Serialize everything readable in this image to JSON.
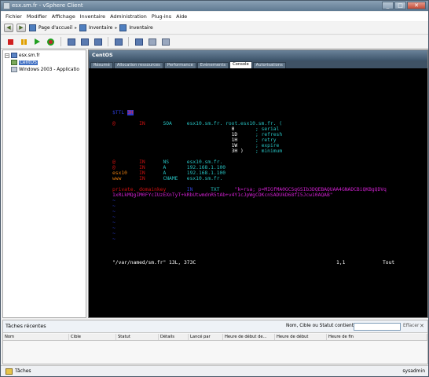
{
  "window": {
    "title": "esx.sm.fr - vSphere Client",
    "min": "_",
    "max": "□",
    "close": "✕"
  },
  "menu": [
    "Fichier",
    "Modifier",
    "Affichage",
    "Inventaire",
    "Administration",
    "Plug-ins",
    "Aide"
  ],
  "nav": {
    "home": "Page d'accueil",
    "inventory": "Inventaire",
    "inventory2": "Inventaire"
  },
  "toolbar": {
    "icons": [
      "power-off-icon",
      "suspend-icon",
      "power-on-icon",
      "reset-icon",
      "snapshot-icon",
      "revert-icon",
      "manage-icon",
      "console-icon",
      "migrate-icon",
      "clone-icon",
      "settings-icon"
    ]
  },
  "tree": {
    "host": "esx.sm.fr",
    "items": [
      {
        "label": "CentOS",
        "selected": true
      },
      {
        "label": "Windows 2003 - Applicatio",
        "selected": false
      }
    ]
  },
  "vm_panel": {
    "title": "CentOS",
    "tabs": [
      "Résumé",
      "Allocation ressources",
      "Performance",
      "Evènements",
      "Console",
      "Autorisations"
    ],
    "active_tab": "Console"
  },
  "console": {
    "lines": [
      {
        "text": "$TTL 3H",
        "color": "#2a3ad0",
        "tokens": [
          {
            "t": "$TTL ",
            "c": "#2a3ad0"
          },
          {
            "t": "3H",
            "c": "#ff2a2a",
            "bg": "#2a3ad0"
          }
        ]
      },
      {
        "text": "@        IN      SOA     esx10.sm.fr. root.esx10.sm.fr. (",
        "tokens": [
          {
            "t": "@        IN      ",
            "c": "#d01010"
          },
          {
            "t": "SOA     esx10.sm.fr. root.esx10.sm.fr. (",
            "c": "#27c0c0"
          }
        ]
      },
      {
        "text": "                                        0       ; serial",
        "tokens": [
          {
            "t": "                                        0       ",
            "c": "#ffffff"
          },
          {
            "t": "; serial",
            "c": "#27c0c0"
          }
        ]
      },
      {
        "text": "                                        1D      ; refresh",
        "tokens": [
          {
            "t": "                                        1D      ",
            "c": "#ffffff"
          },
          {
            "t": "; refresh",
            "c": "#27c0c0"
          }
        ]
      },
      {
        "text": "                                        1H      ; retry",
        "tokens": [
          {
            "t": "                                        1H      ",
            "c": "#ffffff"
          },
          {
            "t": "; retry",
            "c": "#27c0c0"
          }
        ]
      },
      {
        "text": "                                        1W      ; expire",
        "tokens": [
          {
            "t": "                                        1W      ",
            "c": "#ffffff"
          },
          {
            "t": "; expire",
            "c": "#27c0c0"
          }
        ]
      },
      {
        "text": "                                        3H )    ; minimum",
        "tokens": [
          {
            "t": "                                        3H )    ",
            "c": "#ffffff"
          },
          {
            "t": "; minimum",
            "c": "#27c0c0"
          }
        ]
      },
      {
        "text": "",
        "tokens": []
      },
      {
        "text": "@        IN      NS      esx10.sm.fr.",
        "tokens": [
          {
            "t": "@        IN      ",
            "c": "#d01010"
          },
          {
            "t": "NS      esx10.sm.fr.",
            "c": "#27c0c0"
          }
        ]
      },
      {
        "text": "@        IN      A       192.168.1.100",
        "tokens": [
          {
            "t": "@        IN      ",
            "c": "#d01010"
          },
          {
            "t": "A       192.168.1.100",
            "c": "#27c0c0"
          }
        ]
      },
      {
        "text": "esx10    IN      A       192.168.1.100",
        "tokens": [
          {
            "t": "esx10    ",
            "c": "#e07a10"
          },
          {
            "t": "IN      ",
            "c": "#d01010"
          },
          {
            "t": "A       192.168.1.100",
            "c": "#27c0c0"
          }
        ]
      },
      {
        "text": "www      IN      CNAME   esx10.sm.fr.",
        "tokens": [
          {
            "t": "www      ",
            "c": "#e07a10"
          },
          {
            "t": "IN      ",
            "c": "#d01010"
          },
          {
            "t": "CNAME   esx10.sm.fr.",
            "c": "#27c0c0"
          }
        ]
      },
      {
        "text": "",
        "tokens": []
      },
      {
        "text": "private._domainkey       IN      TXT     \"k=rsa; p=MIGfMA0GCSqGSIb3DQEBAQUAA4GNADCBiQKBgQDVq",
        "tokens": [
          {
            "t": "private._domainkey       ",
            "c": "#d01010"
          },
          {
            "t": "IN      ",
            "c": "#3040d0"
          },
          {
            "t": "TXT     ",
            "c": "#27c0c0"
          },
          {
            "t": "\"k=rsa; p=MIGfMA0GCSqGSIb3DQEBAQUAA4GNADCBiQKBgQDVq",
            "c": "#d020d0"
          }
        ]
      },
      {
        "text": "1xRLkMQgIM0FYcIUzEXnTyT+kRbUtwmdnR5tAb+v4Y1cJpWgCOKcnSADUkD68fI5Jcw10AQAB\"",
        "tokens": [
          {
            "t": "1xRLkMQgIM0FYcIUzEXnTyT+kRbUtwmdnR5tAb+v4Y1cJpWgCOKcnSADUkD68fI5Jcw10AQAB\"",
            "c": "#d020d0"
          }
        ]
      },
      {
        "text": "~",
        "tokens": [
          {
            "t": "~",
            "c": "#2a3ad0"
          }
        ]
      },
      {
        "text": "~",
        "tokens": [
          {
            "t": "~",
            "c": "#2a3ad0"
          }
        ]
      },
      {
        "text": "~",
        "tokens": [
          {
            "t": "~",
            "c": "#2a3ad0"
          }
        ]
      },
      {
        "text": "~",
        "tokens": [
          {
            "t": "~",
            "c": "#2a3ad0"
          }
        ]
      },
      {
        "text": "~",
        "tokens": [
          {
            "t": "~",
            "c": "#2a3ad0"
          }
        ]
      },
      {
        "text": "~",
        "tokens": [
          {
            "t": "~",
            "c": "#2a3ad0"
          }
        ]
      },
      {
        "text": "~",
        "tokens": [
          {
            "t": "~",
            "c": "#2a3ad0"
          }
        ]
      },
      {
        "text": "~",
        "tokens": [
          {
            "t": "~",
            "c": "#2a3ad0"
          }
        ]
      },
      {
        "text": "",
        "tokens": []
      },
      {
        "text": "\"/var/named/sm.fr\" 13L, 373C",
        "tokens": [
          {
            "t": "\"/var/named/sm.fr\" 13L, 373C",
            "c": "#ffffff"
          }
        ]
      }
    ],
    "status_pos": "1,1",
    "status_all": "Tout"
  },
  "recent_tasks": {
    "title": "Tâches récentes",
    "filter_label": "Nom, Cible ou Statut contient :",
    "clear": "Effacer",
    "close": "✕",
    "columns": [
      "Nom",
      "Cible",
      "Statut",
      "Détails",
      "Lancé par",
      "Heure de début de...",
      "Heure de début",
      "Heure de fin"
    ]
  },
  "statusbar": {
    "tasks": "Tâches",
    "user": "sysadmin"
  }
}
